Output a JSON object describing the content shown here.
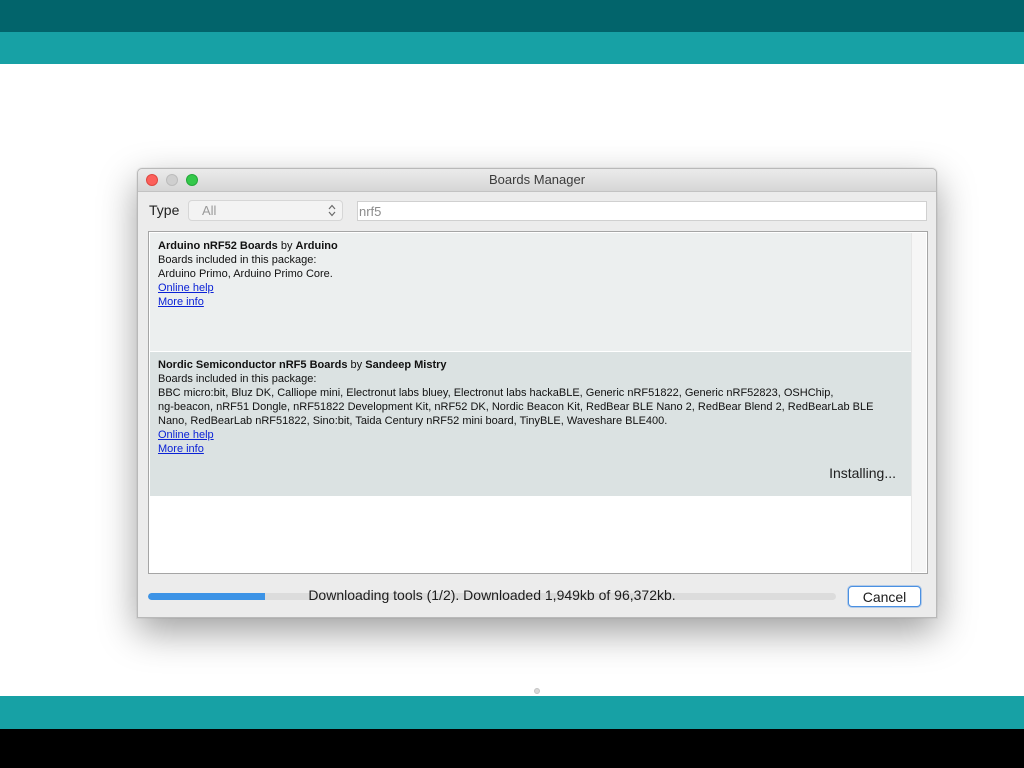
{
  "dialog": {
    "title": "Boards Manager"
  },
  "filter": {
    "type_label": "Type",
    "type_value": "All",
    "search_value": "nrf5"
  },
  "packages": [
    {
      "name": "Arduino nRF52 Boards",
      "by": "by",
      "author": "Arduino",
      "included_label": "Boards included in this package:",
      "boards_lines": [
        "Arduino Primo, Arduino Primo Core."
      ],
      "online_help": "Online help",
      "more_info": "More info"
    },
    {
      "name": "Nordic Semiconductor nRF5 Boards",
      "by": "by",
      "author": "Sandeep Mistry",
      "included_label": "Boards included in this package:",
      "boards_lines": [
        "BBC micro:bit, Bluz DK, Calliope mini, Electronut labs bluey, Electronut labs hackaBLE, Generic nRF51822, Generic nRF52823, OSHChip,",
        "ng-beacon, nRF51 Dongle, nRF51822 Development Kit, nRF52 DK, Nordic Beacon Kit, RedBear BLE Nano 2, RedBear Blend 2, RedBearLab BLE",
        "Nano, RedBearLab nRF51822, Sino:bit, Taida Century nRF52 mini board, TinyBLE, Waveshare BLE400."
      ],
      "online_help": "Online help",
      "more_info": "More info",
      "status": "Installing..."
    }
  ],
  "footer": {
    "progress_fraction": 0.17,
    "progress_text": "Downloading tools (1/2). Downloaded 1,949kb of 96,372kb.",
    "cancel_label": "Cancel"
  },
  "colors": {
    "link": "#0b22d6",
    "progress_fill": "#3c93e6",
    "band_dark": "#02646b",
    "band_teal": "#17a1a5"
  }
}
